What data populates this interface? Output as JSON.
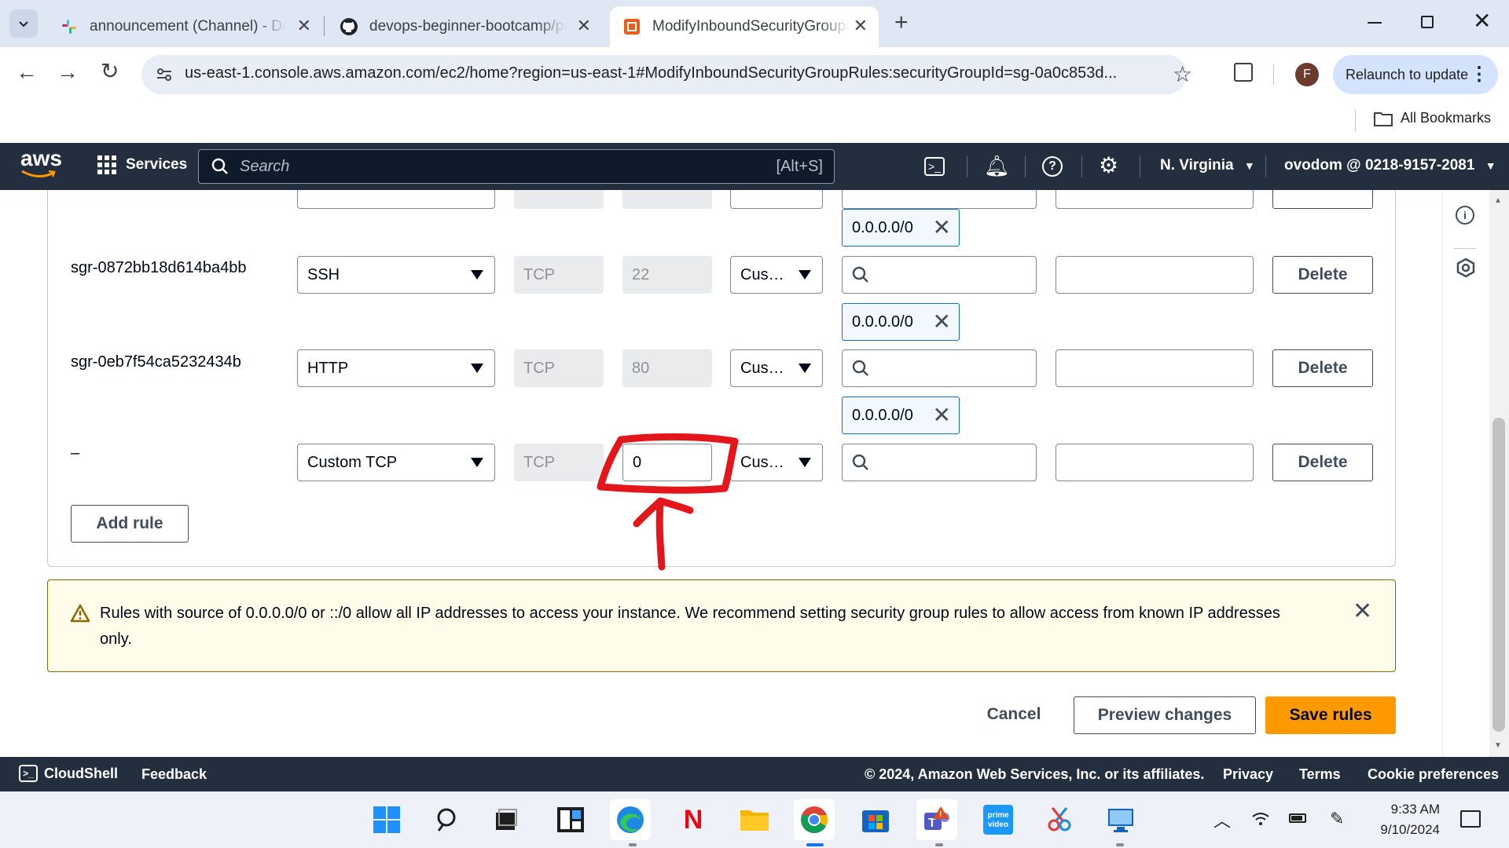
{
  "browser": {
    "tabs": [
      {
        "title": "announcement (Channel) - Dev",
        "icon": "slack-icon"
      },
      {
        "title": "devops-beginner-bootcamp/pr",
        "icon": "github-icon"
      },
      {
        "title": "ModifyInboundSecurityGroupR",
        "icon": "aws-icon",
        "active": true
      }
    ],
    "url": "us-east-1.console.aws.amazon.com/ec2/home?region=us-east-1#ModifyInboundSecurityGroupRules:securityGroupId=sg-0a0c853d...",
    "profile_initial": "F",
    "relaunch_label": "Relaunch to update",
    "bookmarks_label": "All Bookmarks"
  },
  "aws_nav": {
    "logo": "aws",
    "services_label": "Services",
    "search_placeholder": "Search",
    "search_shortcut": "[Alt+S]",
    "region": "N. Virginia",
    "account": "ovodom @ 0218-9157-2081"
  },
  "rules": [
    {
      "id": "sgr-0872bb18d614ba4bb",
      "type": "SSH",
      "protocol": "TCP",
      "port": "22",
      "source": "Cus…",
      "cidr": "0.0.0.0/0",
      "delete": "Delete"
    },
    {
      "id": "sgr-0eb7f54ca5232434b",
      "type": "HTTP",
      "protocol": "TCP",
      "port": "80",
      "source": "Cus…",
      "cidr": "0.0.0.0/0",
      "delete": "Delete"
    },
    {
      "id": "–",
      "type": "Custom TCP",
      "protocol": "TCP",
      "port": "0",
      "source": "Cus…",
      "delete": "Delete"
    }
  ],
  "prev_cidr": "0.0.0.0/0",
  "add_rule_label": "Add rule",
  "warning": {
    "text": "Rules with source of 0.0.0.0/0 or ::/0 allow all IP addresses to access your instance. We recommend setting security group rules to allow access from known IP addresses only."
  },
  "actions": {
    "cancel": "Cancel",
    "preview": "Preview changes",
    "save": "Save rules"
  },
  "footer": {
    "cloudshell": "CloudShell",
    "feedback": "Feedback",
    "copyright": "© 2024, Amazon Web Services, Inc. or its affiliates.",
    "privacy": "Privacy",
    "terms": "Terms",
    "cookies": "Cookie preferences"
  },
  "taskbar": {
    "time": "9:33 AM",
    "date": "9/10/2024"
  },
  "colors": {
    "aws_nav": "#232f3e",
    "save_button": "#ff9900",
    "annotation": "#e3161b"
  }
}
